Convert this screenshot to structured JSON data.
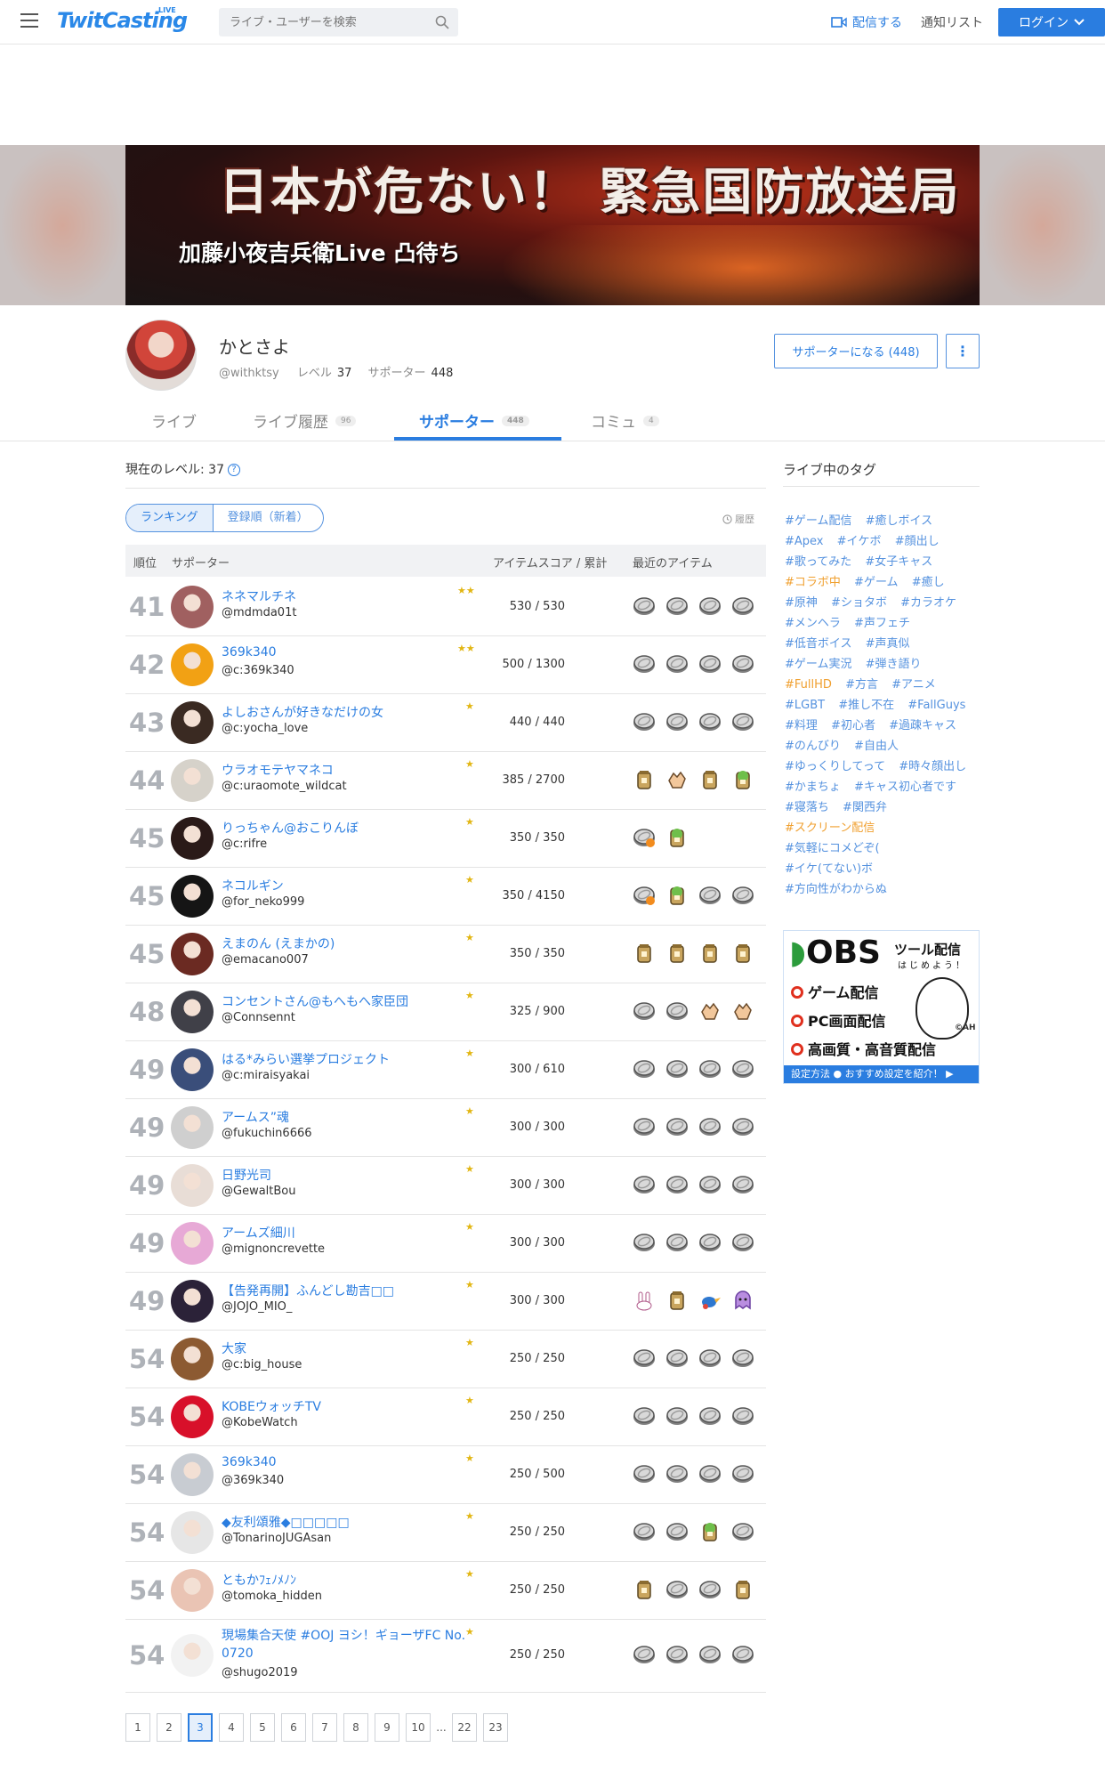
{
  "header": {
    "logo": "TwitCasting",
    "logo_sup": "LIVE",
    "search_placeholder": "ライブ・ユーザーを検索",
    "broadcast": "配信する",
    "notify": "通知リスト",
    "login": "ログイン"
  },
  "banner": {
    "title": "日本が危ない！ 緊急国防放送局",
    "subtitle": "加藤小夜吉兵衛Live 凸待ち"
  },
  "profile": {
    "name": "かとさよ",
    "handle": "@withktsy",
    "level_label": "レベル",
    "level": "37",
    "supporter_label": "サポーター",
    "supporters": "448",
    "support_button": "サポーターになる (448)"
  },
  "tabs": [
    {
      "label": "ライブ",
      "count": ""
    },
    {
      "label": "ライブ履歴",
      "count": "96"
    },
    {
      "label": "サポーター",
      "count": "448"
    },
    {
      "label": "コミュ",
      "count": "4"
    }
  ],
  "main": {
    "current_level": "現在のレベル: 37",
    "sort_ranking": "ランキング",
    "sort_newest": "登録順（新着）",
    "history": "履歴",
    "columns": {
      "rank": "順位",
      "supporter": "サポーター",
      "score": "アイテムスコア / 累計",
      "items": "最近のアイテム"
    }
  },
  "rows": [
    {
      "rank": "41",
      "name": "ネネマルチネ",
      "id": "@mdmda01t",
      "score": "530 / 530",
      "badge": 2,
      "items": [
        "coin",
        "coin",
        "coin",
        "coin"
      ],
      "av": "#a06060"
    },
    {
      "rank": "42",
      "name": "369k340",
      "id": "@c:369k340",
      "score": "500 / 1300",
      "badge": 2,
      "items": [
        "coin",
        "coin",
        "coin",
        "coin"
      ],
      "av": "#f2a114"
    },
    {
      "rank": "43",
      "name": "よしおさんが好きなだけの女",
      "id": "@c:yocha_love",
      "score": "440 / 440",
      "badge": 1,
      "items": [
        "coin",
        "coin",
        "coin",
        "coin"
      ],
      "av": "#3a2a22"
    },
    {
      "rank": "44",
      "name": "ウラオモテヤマネコ",
      "id": "@c:uraomote_wildcat",
      "score": "385 / 2700",
      "badge": 1,
      "items": [
        "jar",
        "clap",
        "jar",
        "jarg"
      ],
      "av": "#d6d2ca"
    },
    {
      "rank": "45",
      "name": "りっちゃん@おこりんぼ",
      "id": "@c:rifre",
      "score": "350 / 350",
      "badge": 1,
      "items": [
        "coin2",
        "jarg"
      ],
      "av": "#2a1a18"
    },
    {
      "rank": "45",
      "name": "ネコルギン",
      "id": "@for_neko999",
      "score": "350 / 4150",
      "badge": 1,
      "items": [
        "coin2",
        "jarg",
        "coin",
        "coin"
      ],
      "av": "#151515"
    },
    {
      "rank": "45",
      "name": "えまのん (えまかの)",
      "id": "@emacano007",
      "score": "350 / 350",
      "badge": 1,
      "items": [
        "jar",
        "jar",
        "jar",
        "jar"
      ],
      "av": "#6b2a22"
    },
    {
      "rank": "48",
      "name": "コンセントさん@もへもへ家臣団",
      "id": "@Connsennt",
      "score": "325 / 900",
      "badge": 1,
      "items": [
        "coin",
        "coin",
        "clap",
        "clap"
      ],
      "av": "#404048"
    },
    {
      "rank": "49",
      "name": "はる*みらい選挙プロジェクト",
      "id": "@c:miraisyakai",
      "score": "300 / 610",
      "badge": 1,
      "items": [
        "coin",
        "coin",
        "coin",
        "coin"
      ],
      "av": "#3a4e7a"
    },
    {
      "rank": "49",
      "name": "アームス”魂",
      "id": "@fukuchin6666",
      "score": "300 / 300",
      "badge": 1,
      "items": [
        "coin",
        "coin",
        "coin",
        "coin"
      ],
      "av": "#cfcfcf"
    },
    {
      "rank": "49",
      "name": "日野光司",
      "id": "@GewaltBou",
      "score": "300 / 300",
      "badge": 1,
      "items": [
        "coin",
        "coin",
        "coin",
        "coin"
      ],
      "av": "#e8ddd6"
    },
    {
      "rank": "49",
      "name": "アームズ細川",
      "id": "@mignoncrevette",
      "score": "300 / 300",
      "badge": 1,
      "items": [
        "coin",
        "coin",
        "coin",
        "coin"
      ],
      "av": "#e7a9d6"
    },
    {
      "rank": "49",
      "name": "【告発再開】ふんどし勘吉□□",
      "id": "@JOJO_MIO_",
      "score": "300 / 300",
      "badge": 1,
      "items": [
        "bunny",
        "jar",
        "bird",
        "ghost"
      ],
      "av": "#2b2238"
    },
    {
      "rank": "54",
      "name": "大家",
      "id": "@c:big_house",
      "score": "250 / 250",
      "badge": 1,
      "items": [
        "coin",
        "coin",
        "coin",
        "coin"
      ],
      "av": "#8c5a32"
    },
    {
      "rank": "54",
      "name": "KOBEウォッチTV",
      "id": "@KobeWatch",
      "score": "250 / 250",
      "badge": 1,
      "items": [
        "coin",
        "coin",
        "coin",
        "coin"
      ],
      "av": "#d8102a"
    },
    {
      "rank": "54",
      "name": "369k340",
      "id": "@369k340",
      "score": "250 / 500",
      "badge": 1,
      "items": [
        "coin",
        "coin",
        "coin",
        "coin"
      ],
      "av": "#c8ccd2"
    },
    {
      "rank": "54",
      "name": "◆友利頌雅◆□□□□□",
      "id": "@TonarinoJUGAsan",
      "score": "250 / 250",
      "badge": 1,
      "items": [
        "coin",
        "coin",
        "jarg",
        "coin"
      ],
      "av": "#e6e6e6"
    },
    {
      "rank": "54",
      "name": "ともかﾌｪﾉﾒﾉﾝ",
      "id": "@tomoka_hidden",
      "score": "250 / 250",
      "badge": 1,
      "items": [
        "jar",
        "coin",
        "coin",
        "jar"
      ],
      "av": "#eac4b4"
    },
    {
      "rank": "54",
      "name": "現場集合天使 #OOJ ヨシ！ギョーザFC No. 0720",
      "id": "@shugo2019",
      "score": "250 / 250",
      "badge": 1,
      "items": [
        "coin",
        "coin",
        "coin",
        "coin"
      ],
      "av": "#f2f2f2"
    }
  ],
  "sidebar": {
    "title": "ライブ中のタグ",
    "tags": [
      {
        "t": "#ゲーム配信",
        "o": false
      },
      {
        "t": "#癒しボイス",
        "o": false
      },
      {
        "t": "#Apex",
        "o": false
      },
      {
        "t": "#イケボ",
        "o": false
      },
      {
        "t": "#顔出し",
        "o": false
      },
      {
        "t": "#歌ってみた",
        "o": false
      },
      {
        "t": "#女子キャス",
        "o": false
      },
      {
        "t": "#コラボ中",
        "o": true
      },
      {
        "t": "#ゲーム",
        "o": false
      },
      {
        "t": "#癒し",
        "o": false
      },
      {
        "t": "#原神",
        "o": false
      },
      {
        "t": "#ショタボ",
        "o": false
      },
      {
        "t": "#カラオケ",
        "o": false
      },
      {
        "t": "#メンヘラ",
        "o": false
      },
      {
        "t": "#声フェチ",
        "o": false
      },
      {
        "t": "#低音ボイス",
        "o": false
      },
      {
        "t": "#声真似",
        "o": false
      },
      {
        "t": "#ゲーム実況",
        "o": false
      },
      {
        "t": "#弾き語り",
        "o": false
      },
      {
        "t": "#FullHD",
        "o": true
      },
      {
        "t": "#方言",
        "o": false
      },
      {
        "t": "#アニメ",
        "o": false
      },
      {
        "t": "#LGBT",
        "o": false
      },
      {
        "t": "#推し不在",
        "o": false
      },
      {
        "t": "#FallGuys",
        "o": false
      },
      {
        "t": "#料理",
        "o": false
      },
      {
        "t": "#初心者",
        "o": false
      },
      {
        "t": "#過疎キャス",
        "o": false
      },
      {
        "t": "#のんびり",
        "o": false
      },
      {
        "t": "#自由人",
        "o": false
      },
      {
        "t": "#ゆっくりしてって",
        "o": false
      },
      {
        "t": "#時々顔出し",
        "o": false
      },
      {
        "t": "#かまちょ",
        "o": false
      },
      {
        "t": "#キャス初心者です",
        "o": false
      },
      {
        "t": "#寝落ち",
        "o": false
      },
      {
        "t": "#関西弁",
        "o": false
      },
      {
        "t": "#スクリーン配信",
        "o": true
      },
      {
        "t": "#気軽にコメどぞ(",
        "o": false
      },
      {
        "t": "#イケ(てない)ボ",
        "o": false
      },
      {
        "t": "#方向性がわからぬ",
        "o": false
      }
    ],
    "obs": {
      "logo": "OBS",
      "title": "ツール配信",
      "subtitle": "はじめよう！",
      "points": [
        "ゲーム配信",
        "PC画面配信",
        "高画質・高音質配信"
      ],
      "credit": "©AH",
      "footer": "設定方法 ● おすすめ設定を紹介！ ▶"
    }
  },
  "pagination": [
    "1",
    "2",
    "3",
    "4",
    "5",
    "6",
    "7",
    "8",
    "9",
    "10",
    "...",
    "22",
    "23"
  ],
  "pagination_current": "3"
}
